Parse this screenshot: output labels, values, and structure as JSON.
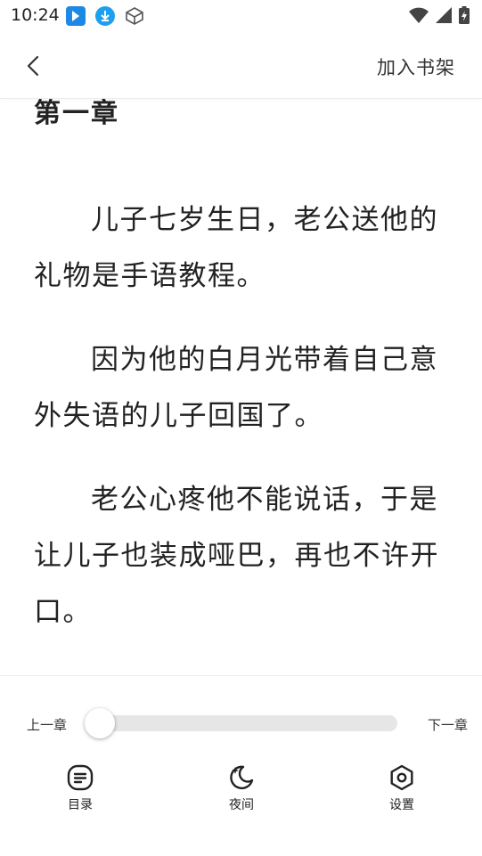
{
  "status_bar": {
    "time": "10:24"
  },
  "header": {
    "add_to_shelf": "加入书架"
  },
  "reader": {
    "chapter_title": "第一章",
    "paragraphs": [
      "儿子七岁生日，老公送他的礼物是手语教程。",
      "因为他的白月光带着自己意外失语的儿子回国了。",
      "老公心疼他不能说话，于是让儿子也装成哑巴，再也不许开口。"
    ]
  },
  "progress": {
    "prev_label": "上一章",
    "next_label": "下一章",
    "value": 0
  },
  "toolbar": {
    "items": [
      {
        "label": "目录",
        "icon": "catalog-icon"
      },
      {
        "label": "夜间",
        "icon": "night-mode-icon"
      },
      {
        "label": "设置",
        "icon": "settings-icon"
      }
    ]
  },
  "colors": {
    "background": "#ffffff",
    "text": "#222222",
    "track": "#e6e6e6",
    "status_blue": "#1e88e5"
  }
}
